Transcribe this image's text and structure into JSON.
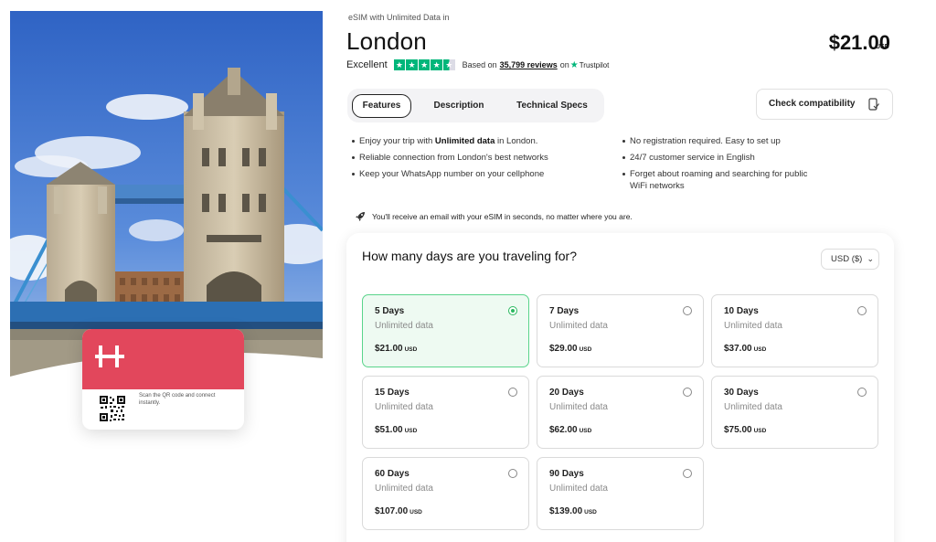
{
  "hero": {
    "image_alt": "Tower Bridge, London",
    "card_qr_text": "Scan the QR code and connect instantly."
  },
  "product": {
    "subtitle": "eSIM with Unlimited Data in",
    "title": "London",
    "price": "$21.00",
    "currency": "USD"
  },
  "rating": {
    "label": "Excellent",
    "based_on": "Based on",
    "reviews": "35,799 reviews",
    "on": "on",
    "provider": "Trustpilot",
    "stars": 4.5
  },
  "tabs": [
    {
      "label": "Features",
      "active": true
    },
    {
      "label": "Description",
      "active": false
    },
    {
      "label": "Technical Specs",
      "active": false
    }
  ],
  "compat_label": "Check compatibility",
  "features": {
    "left": [
      {
        "pre": "Enjoy your trip with ",
        "bold": "Unlimited data",
        "post": " in London."
      },
      {
        "pre": "Reliable connection from London's best networks",
        "bold": "",
        "post": ""
      },
      {
        "pre": "Keep your WhatsApp number on your cellphone",
        "bold": "",
        "post": ""
      }
    ],
    "right": [
      "No registration required. Easy to set up",
      "24/7 customer service in English",
      "Forget about roaming and searching for public WiFi networks"
    ]
  },
  "notice": "You'll receive an email with your eSIM in seconds, no matter where you are.",
  "picker": {
    "question": "How many days are you traveling for?",
    "currency_select": "USD ($)",
    "plans": [
      {
        "days": "5 Days",
        "sub": "Unlimited data",
        "price": "$21.00",
        "cur": "USD",
        "selected": true
      },
      {
        "days": "7 Days",
        "sub": "Unlimited data",
        "price": "$29.00",
        "cur": "USD",
        "selected": false
      },
      {
        "days": "10 Days",
        "sub": "Unlimited data",
        "price": "$37.00",
        "cur": "USD",
        "selected": false
      },
      {
        "days": "15 Days",
        "sub": "Unlimited data",
        "price": "$51.00",
        "cur": "USD",
        "selected": false
      },
      {
        "days": "20 Days",
        "sub": "Unlimited data",
        "price": "$62.00",
        "cur": "USD",
        "selected": false
      },
      {
        "days": "30 Days",
        "sub": "Unlimited data",
        "price": "$75.00",
        "cur": "USD",
        "selected": false
      },
      {
        "days": "60 Days",
        "sub": "Unlimited data",
        "price": "$107.00",
        "cur": "USD",
        "selected": false
      },
      {
        "days": "90 Days",
        "sub": "Unlimited data",
        "price": "$139.00",
        "cur": "USD",
        "selected": false
      }
    ]
  },
  "colors": {
    "brand_red": "#e2475c",
    "trustpilot_green": "#00b67a",
    "selected_green": "#2bb960"
  }
}
